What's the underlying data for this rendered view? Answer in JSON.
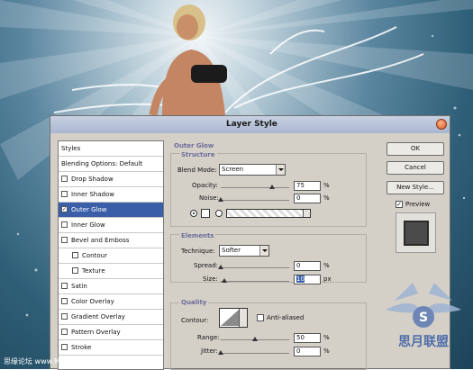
{
  "dialog": {
    "title": "Layer Style",
    "styles_list": [
      {
        "label": "Styles",
        "checkbox": false,
        "checked": false,
        "selected": false,
        "indent": 0
      },
      {
        "label": "Blending Options: Default",
        "checkbox": false,
        "checked": false,
        "selected": false,
        "indent": 0
      },
      {
        "label": "Drop Shadow",
        "checkbox": true,
        "checked": false,
        "selected": false,
        "indent": 0
      },
      {
        "label": "Inner Shadow",
        "checkbox": true,
        "checked": false,
        "selected": false,
        "indent": 0
      },
      {
        "label": "Outer Glow",
        "checkbox": true,
        "checked": true,
        "selected": true,
        "indent": 0
      },
      {
        "label": "Inner Glow",
        "checkbox": true,
        "checked": false,
        "selected": false,
        "indent": 0
      },
      {
        "label": "Bevel and Emboss",
        "checkbox": true,
        "checked": false,
        "selected": false,
        "indent": 0
      },
      {
        "label": "Contour",
        "checkbox": true,
        "checked": false,
        "selected": false,
        "indent": 1
      },
      {
        "label": "Texture",
        "checkbox": true,
        "checked": false,
        "selected": false,
        "indent": 1
      },
      {
        "label": "Satin",
        "checkbox": true,
        "checked": false,
        "selected": false,
        "indent": 0
      },
      {
        "label": "Color Overlay",
        "checkbox": true,
        "checked": false,
        "selected": false,
        "indent": 0
      },
      {
        "label": "Gradient Overlay",
        "checkbox": true,
        "checked": false,
        "selected": false,
        "indent": 0
      },
      {
        "label": "Pattern Overlay",
        "checkbox": true,
        "checked": false,
        "selected": false,
        "indent": 0
      },
      {
        "label": "Stroke",
        "checkbox": true,
        "checked": false,
        "selected": false,
        "indent": 0
      }
    ],
    "outer_glow": {
      "section_title": "Outer Glow",
      "structure_title": "Structure",
      "blend_mode_label": "Blend Mode:",
      "blend_mode_value": "Screen",
      "opacity_label": "Opacity:",
      "opacity_value": "75",
      "opacity_level_percent": 75,
      "noise_label": "Noise:",
      "noise_value": "0",
      "noise_level_percent": 0,
      "percent_unit": "%",
      "elements_title": "Elements",
      "technique_label": "Technique:",
      "technique_value": "Softer",
      "spread_label": "Spread:",
      "spread_value": "0",
      "spread_level_percent": 0,
      "size_label": "Size:",
      "size_value": "10",
      "size_unit": "px",
      "quality_title": "Quality",
      "contour_label": "Contour:",
      "antialiased_label": "Anti-aliased",
      "antialiased_checked": false,
      "range_label": "Range:",
      "range_value": "50",
      "range_level_percent": 50,
      "jitter_label": "Jitter:",
      "jitter_value": "0",
      "jitter_level_percent": 0
    },
    "buttons": {
      "ok": "OK",
      "cancel": "Cancel",
      "new_style": "New Style...",
      "preview_label": "Preview",
      "preview_checked": true
    }
  },
  "watermarks": {
    "bottom_left": "思缘论坛 www.MISSYUAN.com",
    "logo_text": "思月联盟"
  },
  "colors": {
    "selection": "#3a5fa8",
    "dialog_bg": "#d4d0c8",
    "sea_dark": "#1d4358"
  }
}
